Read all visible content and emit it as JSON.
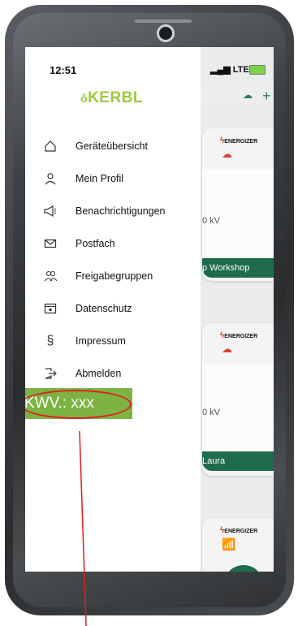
{
  "status_bar": {
    "time": "12:51",
    "network": "LTE"
  },
  "app": {
    "logo": "KERBL"
  },
  "menu": [
    {
      "label": "Geräteübersicht",
      "icon": "home-icon"
    },
    {
      "label": "Mein Profil",
      "icon": "user-icon"
    },
    {
      "label": "Benachrichtigungen",
      "icon": "megaphone-icon"
    },
    {
      "label": "Postfach",
      "icon": "mail-icon"
    },
    {
      "label": "Freigabegruppen",
      "icon": "group-icon"
    },
    {
      "label": "Datenschutz",
      "icon": "folder-lock-icon"
    },
    {
      "label": "Impressum",
      "icon": "paragraph-icon"
    },
    {
      "label": "Abmelden",
      "icon": "logout-icon"
    }
  ],
  "annotation": {
    "text": "KWV.: xxx",
    "color": "#7cb342",
    "ring_color": "#e02020"
  },
  "background_cards": [
    {
      "brand": "ENERGIZER",
      "reading": "0 kV",
      "name": "p Workshop"
    },
    {
      "brand": "ENERGIZER",
      "reading": "0 kV",
      "name": "Laura"
    },
    {
      "brand": "ENERGIZER"
    }
  ],
  "colors": {
    "brand_green": "#9cc93a",
    "card_footer": "#1e6b4d"
  }
}
